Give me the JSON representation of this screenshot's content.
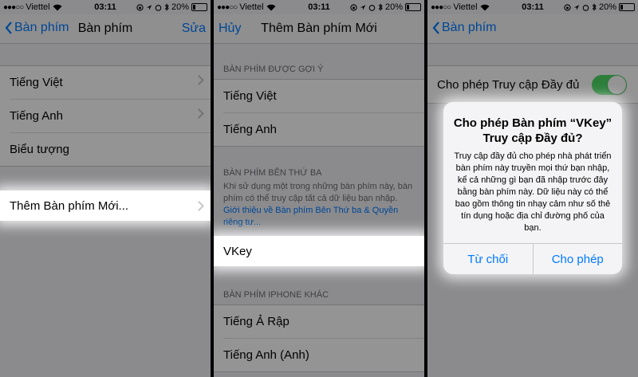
{
  "status": {
    "carrier": "Viettel",
    "time": "03:11",
    "battery": "20%",
    "signal_dots": "●●●○○"
  },
  "panel1": {
    "back": "Bàn phím",
    "title": "Bàn phím",
    "action": "Sửa",
    "items": [
      {
        "label": "Tiếng Việt"
      },
      {
        "label": "Tiếng Anh"
      },
      {
        "label": "Biểu tượng"
      }
    ],
    "add_keyboard": "Thêm Bàn phím Mới..."
  },
  "panel2": {
    "cancel": "Hủy",
    "title": "Thêm Bàn phím Mới",
    "suggested_header": "BÀN PHÍM ĐƯỢC GỢI Ý",
    "suggested": [
      {
        "label": "Tiếng Việt"
      },
      {
        "label": "Tiếng Anh"
      }
    ],
    "third_party_header": "BÀN PHÍM BÊN THỨ BA",
    "third_party_note": "Khi sử dụng một trong những bàn phím này, bàn phím có thể truy cập tất cả dữ liệu bạn nhập. ",
    "third_party_link": "Giới thiệu về Bàn phím Bên Thứ ba & Quyền riêng tư...",
    "vkey": "VKey",
    "other_header": "BÀN PHÍM IPHONE KHÁC",
    "other": [
      {
        "label": "Tiếng Ả Rập"
      },
      {
        "label": "Tiếng Anh (Anh)"
      }
    ]
  },
  "panel3": {
    "back": "Bàn phím",
    "allow_full_access": "Cho phép Truy cập Đầy đủ",
    "toggle_on": true,
    "alert": {
      "title": "Cho phép Bàn phím “VKey” Truy cập Đầy đủ?",
      "message": "Truy cập đầy đủ cho phép nhà phát triển bàn phím này truyền mọi thứ bạn nhập, kể cả những gì bạn đã nhập trước đây bằng bàn phím này. Dữ liệu này có thể bao gồm thông tin nhạy cảm như số thẻ tín dụng hoặc địa chỉ đường phố của bạn.",
      "deny": "Từ chối",
      "allow": "Cho phép"
    }
  },
  "colors": {
    "accent": "#007aff",
    "toggle_on": "#4cd964",
    "background": "#efeff4"
  }
}
